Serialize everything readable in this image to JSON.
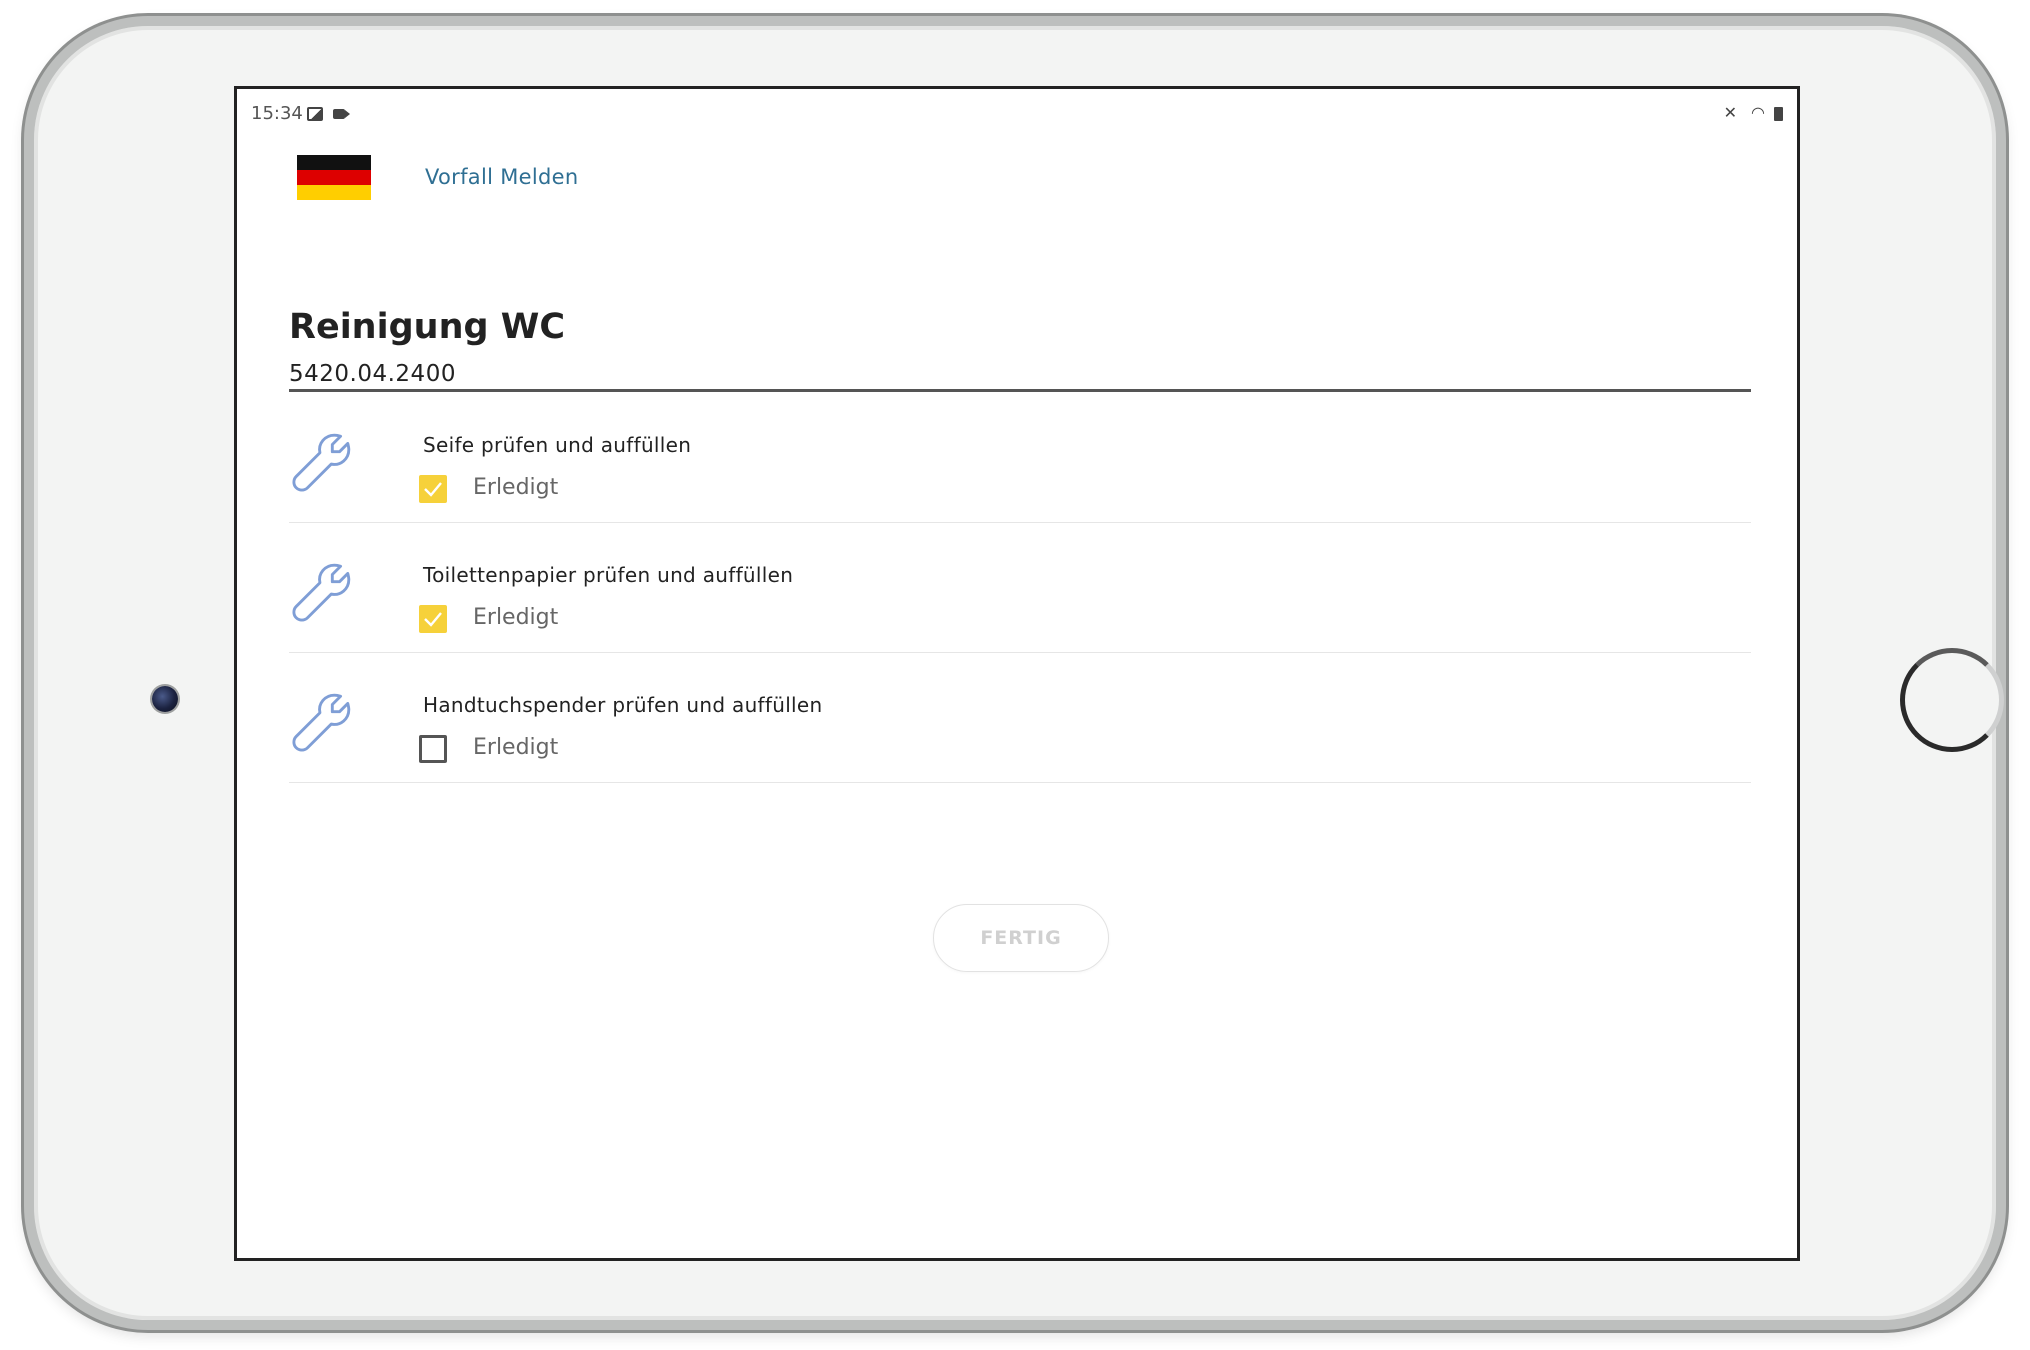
{
  "statusbar": {
    "time": "15:34",
    "icons": [
      "gallery-icon",
      "video-icon",
      "mute-icon",
      "wifi-icon",
      "battery-icon"
    ]
  },
  "header": {
    "flag": "germany-flag",
    "report_link": "Vorfall Melden"
  },
  "page": {
    "title": "Reinigung WC",
    "code": "5420.04.2400"
  },
  "tasks": [
    {
      "title": "Seife prüfen und auffüllen",
      "check_label": "Erledigt",
      "checked": true
    },
    {
      "title": "Toilettenpapier prüfen und auffüllen",
      "check_label": "Erledigt",
      "checked": true
    },
    {
      "title": "Handtuchspender prüfen und auffüllen",
      "check_label": "Erledigt",
      "checked": false
    }
  ],
  "actions": {
    "done_label": "FERTIG"
  },
  "colors": {
    "accent_link": "#2f6f93",
    "checkbox_checked": "#f6d13a",
    "wrench_icon": "#7f9ed6"
  }
}
